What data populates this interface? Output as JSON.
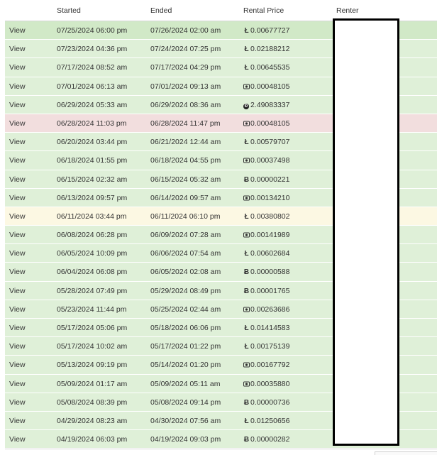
{
  "headers": {
    "started": "Started",
    "ended": "Ended",
    "price": "Rental Price",
    "renter": "Renter"
  },
  "colors": {
    "green": "#dff0d8",
    "green_selected": "#d1e9c7",
    "red": "#f2dede",
    "yellow": "#fcf8e3"
  },
  "rows": [
    {
      "action": "View",
      "started": "07/25/2024 06:00 pm",
      "ended": "07/26/2024 02:00 am",
      "currency": "ltc",
      "price": "0.00677727",
      "status": "green_selected"
    },
    {
      "action": "View",
      "started": "07/23/2024 04:36 pm",
      "ended": "07/24/2024 07:25 pm",
      "currency": "ltc",
      "price": "0.02188212",
      "status": "green"
    },
    {
      "action": "View",
      "started": "07/17/2024 08:52 am",
      "ended": "07/17/2024 04:29 pm",
      "currency": "ltc",
      "price": "0.00645535",
      "status": "green"
    },
    {
      "action": "View",
      "started": "07/01/2024 06:13 am",
      "ended": "07/01/2024 09:13 am",
      "currency": "bch",
      "price": "0.00048105",
      "status": "green"
    },
    {
      "action": "View",
      "started": "06/29/2024 05:33 am",
      "ended": "06/29/2024 08:36 am",
      "currency": "doge",
      "price": "2.49083337",
      "status": "green"
    },
    {
      "action": "View",
      "started": "06/28/2024 11:03 pm",
      "ended": "06/28/2024 11:47 pm",
      "currency": "bch",
      "price": "0.00048105",
      "status": "red"
    },
    {
      "action": "View",
      "started": "06/20/2024 03:44 pm",
      "ended": "06/21/2024 12:44 am",
      "currency": "ltc",
      "price": "0.00579707",
      "status": "green"
    },
    {
      "action": "View",
      "started": "06/18/2024 01:55 pm",
      "ended": "06/18/2024 04:55 pm",
      "currency": "bch",
      "price": "0.00037498",
      "status": "green"
    },
    {
      "action": "View",
      "started": "06/15/2024 02:32 am",
      "ended": "06/15/2024 05:32 am",
      "currency": "btc",
      "price": "0.00000221",
      "status": "green"
    },
    {
      "action": "View",
      "started": "06/13/2024 09:57 pm",
      "ended": "06/14/2024 09:57 am",
      "currency": "bch",
      "price": "0.00134210",
      "status": "green"
    },
    {
      "action": "View",
      "started": "06/11/2024 03:44 pm",
      "ended": "06/11/2024 06:10 pm",
      "currency": "ltc",
      "price": "0.00380802",
      "status": "yellow"
    },
    {
      "action": "View",
      "started": "06/08/2024 06:28 pm",
      "ended": "06/09/2024 07:28 am",
      "currency": "bch",
      "price": "0.00141989",
      "status": "green"
    },
    {
      "action": "View",
      "started": "06/05/2024 10:09 pm",
      "ended": "06/06/2024 07:54 am",
      "currency": "ltc",
      "price": "0.00602684",
      "status": "green"
    },
    {
      "action": "View",
      "started": "06/04/2024 06:08 pm",
      "ended": "06/05/2024 02:08 am",
      "currency": "btc",
      "price": "0.00000588",
      "status": "green"
    },
    {
      "action": "View",
      "started": "05/28/2024 07:49 pm",
      "ended": "05/29/2024 08:49 pm",
      "currency": "btc",
      "price": "0.00001765",
      "status": "green"
    },
    {
      "action": "View",
      "started": "05/23/2024 11:44 pm",
      "ended": "05/25/2024 02:44 am",
      "currency": "bch",
      "price": "0.00263686",
      "status": "green"
    },
    {
      "action": "View",
      "started": "05/17/2024 05:06 pm",
      "ended": "05/18/2024 06:06 pm",
      "currency": "ltc",
      "price": "0.01414583",
      "status": "green"
    },
    {
      "action": "View",
      "started": "05/17/2024 10:02 am",
      "ended": "05/17/2024 01:22 pm",
      "currency": "ltc",
      "price": "0.00175139",
      "status": "green"
    },
    {
      "action": "View",
      "started": "05/13/2024 09:19 pm",
      "ended": "05/14/2024 01:20 pm",
      "currency": "bch",
      "price": "0.00167792",
      "status": "green"
    },
    {
      "action": "View",
      "started": "05/09/2024 01:17 am",
      "ended": "05/09/2024 05:11 am",
      "currency": "bch",
      "price": "0.00035880",
      "status": "green"
    },
    {
      "action": "View",
      "started": "05/08/2024 08:39 pm",
      "ended": "05/08/2024 09:14 pm",
      "currency": "btc",
      "price": "0.00000736",
      "status": "green"
    },
    {
      "action": "View",
      "started": "04/29/2024 08:23 am",
      "ended": "04/30/2024 07:56 am",
      "currency": "ltc",
      "price": "0.01250656",
      "status": "green"
    },
    {
      "action": "View",
      "started": "04/19/2024 06:03 pm",
      "ended": "04/19/2024 09:03 pm",
      "currency": "btc",
      "price": "0.00000282",
      "status": "green"
    }
  ]
}
